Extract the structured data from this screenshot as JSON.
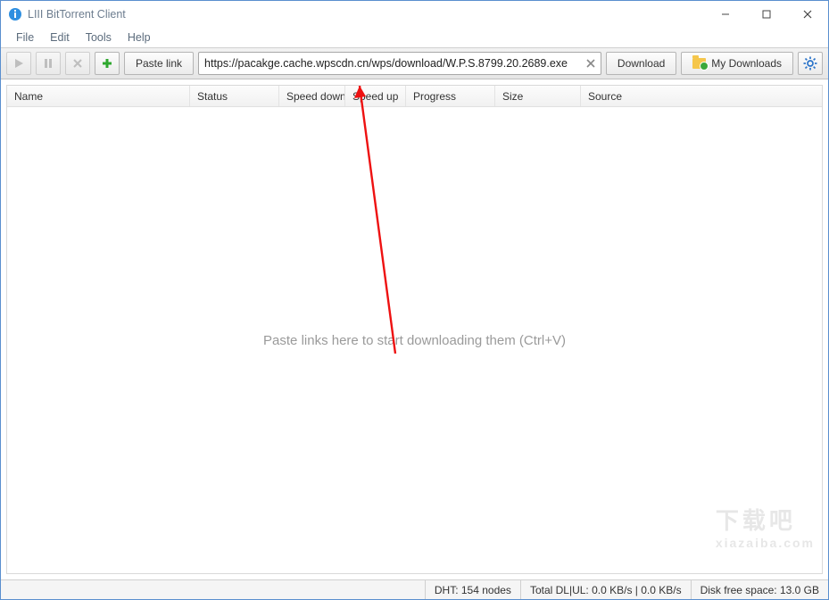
{
  "window": {
    "title": "LIII BitTorrent Client"
  },
  "menu": {
    "items": [
      "File",
      "Edit",
      "Tools",
      "Help"
    ]
  },
  "toolbar": {
    "paste_link": "Paste link",
    "download": "Download",
    "my_downloads": "My Downloads",
    "url_value": "https://pacakge.cache.wpscdn.cn/wps/download/W.P.S.8799.20.2689.exe"
  },
  "columns": {
    "name": "Name",
    "status": "Status",
    "speed_down": "Speed down",
    "speed_up": "Speed up",
    "progress": "Progress",
    "size": "Size",
    "source": "Source"
  },
  "empty_hint": "Paste links here to start downloading them (Ctrl+V)",
  "status": {
    "dht": "DHT: 154 nodes",
    "speeds": "Total DL|UL: 0.0 KB/s | 0.0 KB/s",
    "disk": "Disk free space: 13.0 GB"
  },
  "watermark": {
    "big": "下载吧",
    "small": "xiazaiba.com"
  }
}
